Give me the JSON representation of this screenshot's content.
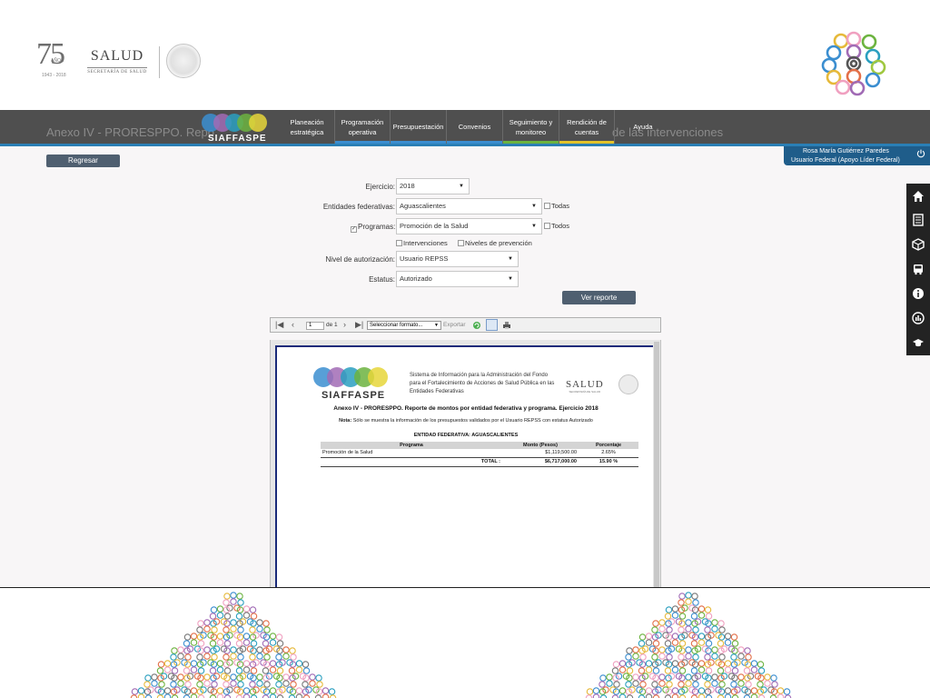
{
  "header": {
    "logo_75": "75",
    "logo_anos": "AÑOS",
    "logo_years": "1943 - 2018",
    "salud_word": "SALUD",
    "salud_sub": "SECRETARÍA DE SALUD"
  },
  "nav": {
    "brand": "SIAFFASPE",
    "ghost_title_left": "Anexo IV - PRORESPPO. Repo",
    "ghost_title_right": "de las intervenciones",
    "items": [
      {
        "label": "Planeación estratégica",
        "stripe": ""
      },
      {
        "label": "Programación operativa",
        "stripe": "#3b8ed0"
      },
      {
        "label": "Presupuestación",
        "stripe": "#3b8ed0"
      },
      {
        "label": "Convenios",
        "stripe": "#3b8ed0"
      },
      {
        "label": "Seguimiento y monitoreo",
        "stripe": "#6cb33f"
      },
      {
        "label": "Rendición de cuentas",
        "stripe": "#e3c32a"
      },
      {
        "label": "Ayuda",
        "stripe": ""
      }
    ]
  },
  "user": {
    "name": "Rosa María Gutiérrez Paredes",
    "role": "Usuario Federal (Apoyo Líder Federal)"
  },
  "actions": {
    "regresar": "Regresar",
    "ver_reporte": "Ver reporte"
  },
  "form": {
    "ejercicio_label": "Ejercicio:",
    "ejercicio_value": "2018",
    "entidades_label": "Entidades federativas:",
    "entidades_value": "Aguascalientes",
    "todas_label": "Todas",
    "programas_label": "Programas:",
    "programas_value": "Promoción de la Salud",
    "todos_label": "Todos",
    "intervenciones_label": "Intervenciones",
    "niveles_label": "Niveles de prevención",
    "nivel_label": "Nivel de autorización:",
    "nivel_value": "Usuario REPSS",
    "estatus_label": "Estatus:",
    "estatus_value": "Autorizado"
  },
  "toolbar": {
    "page_current": "1",
    "page_of": "de 1",
    "format_placeholder": "Seleccionar formato...",
    "export_label": "Exportar"
  },
  "report": {
    "brand": "SIAFFASPE",
    "system_name": "Sistema de Información para la Administración del Fondo para el Fortalecimiento de Acciones de Salud Pública en las Entidades Federativas",
    "salud_word": "SALUD",
    "salud_sub": "SECRETARÍA DE SALUD",
    "title": "Anexo IV - PRORESPPO. Reporte de montos por entidad federativa y programa. Ejercicio  2018",
    "note_label": "Nota:",
    "note_text": "Sólo se muestra la información de los presupuestos validados por el Usuario REPSS con estatus Autorizado",
    "entity": "ENTIDAD FEDERATIVA: AGUASCALIENTES",
    "columns": [
      "Programa",
      "Monto (Pesos)",
      "Porcentaje"
    ],
    "rows": [
      {
        "programa": "Promoción de la Salud",
        "monto": "$1,119,500.00",
        "porcentaje": "2.65%"
      }
    ],
    "total_label": "TOTAL :",
    "total_monto": "$6,717,000.00",
    "total_porcentaje": "15.90 %"
  },
  "side_menu": [
    "home-icon",
    "list-icon",
    "cube-icon",
    "bus-icon",
    "info-icon",
    "chart-icon",
    "graduation-cap-icon"
  ],
  "colors": {
    "navbar": "#4f4f4f",
    "content_bg": "#f8f6f7",
    "button": "#4f5f70",
    "user_box": "#1f5d8a",
    "side_menu": "#232323"
  }
}
